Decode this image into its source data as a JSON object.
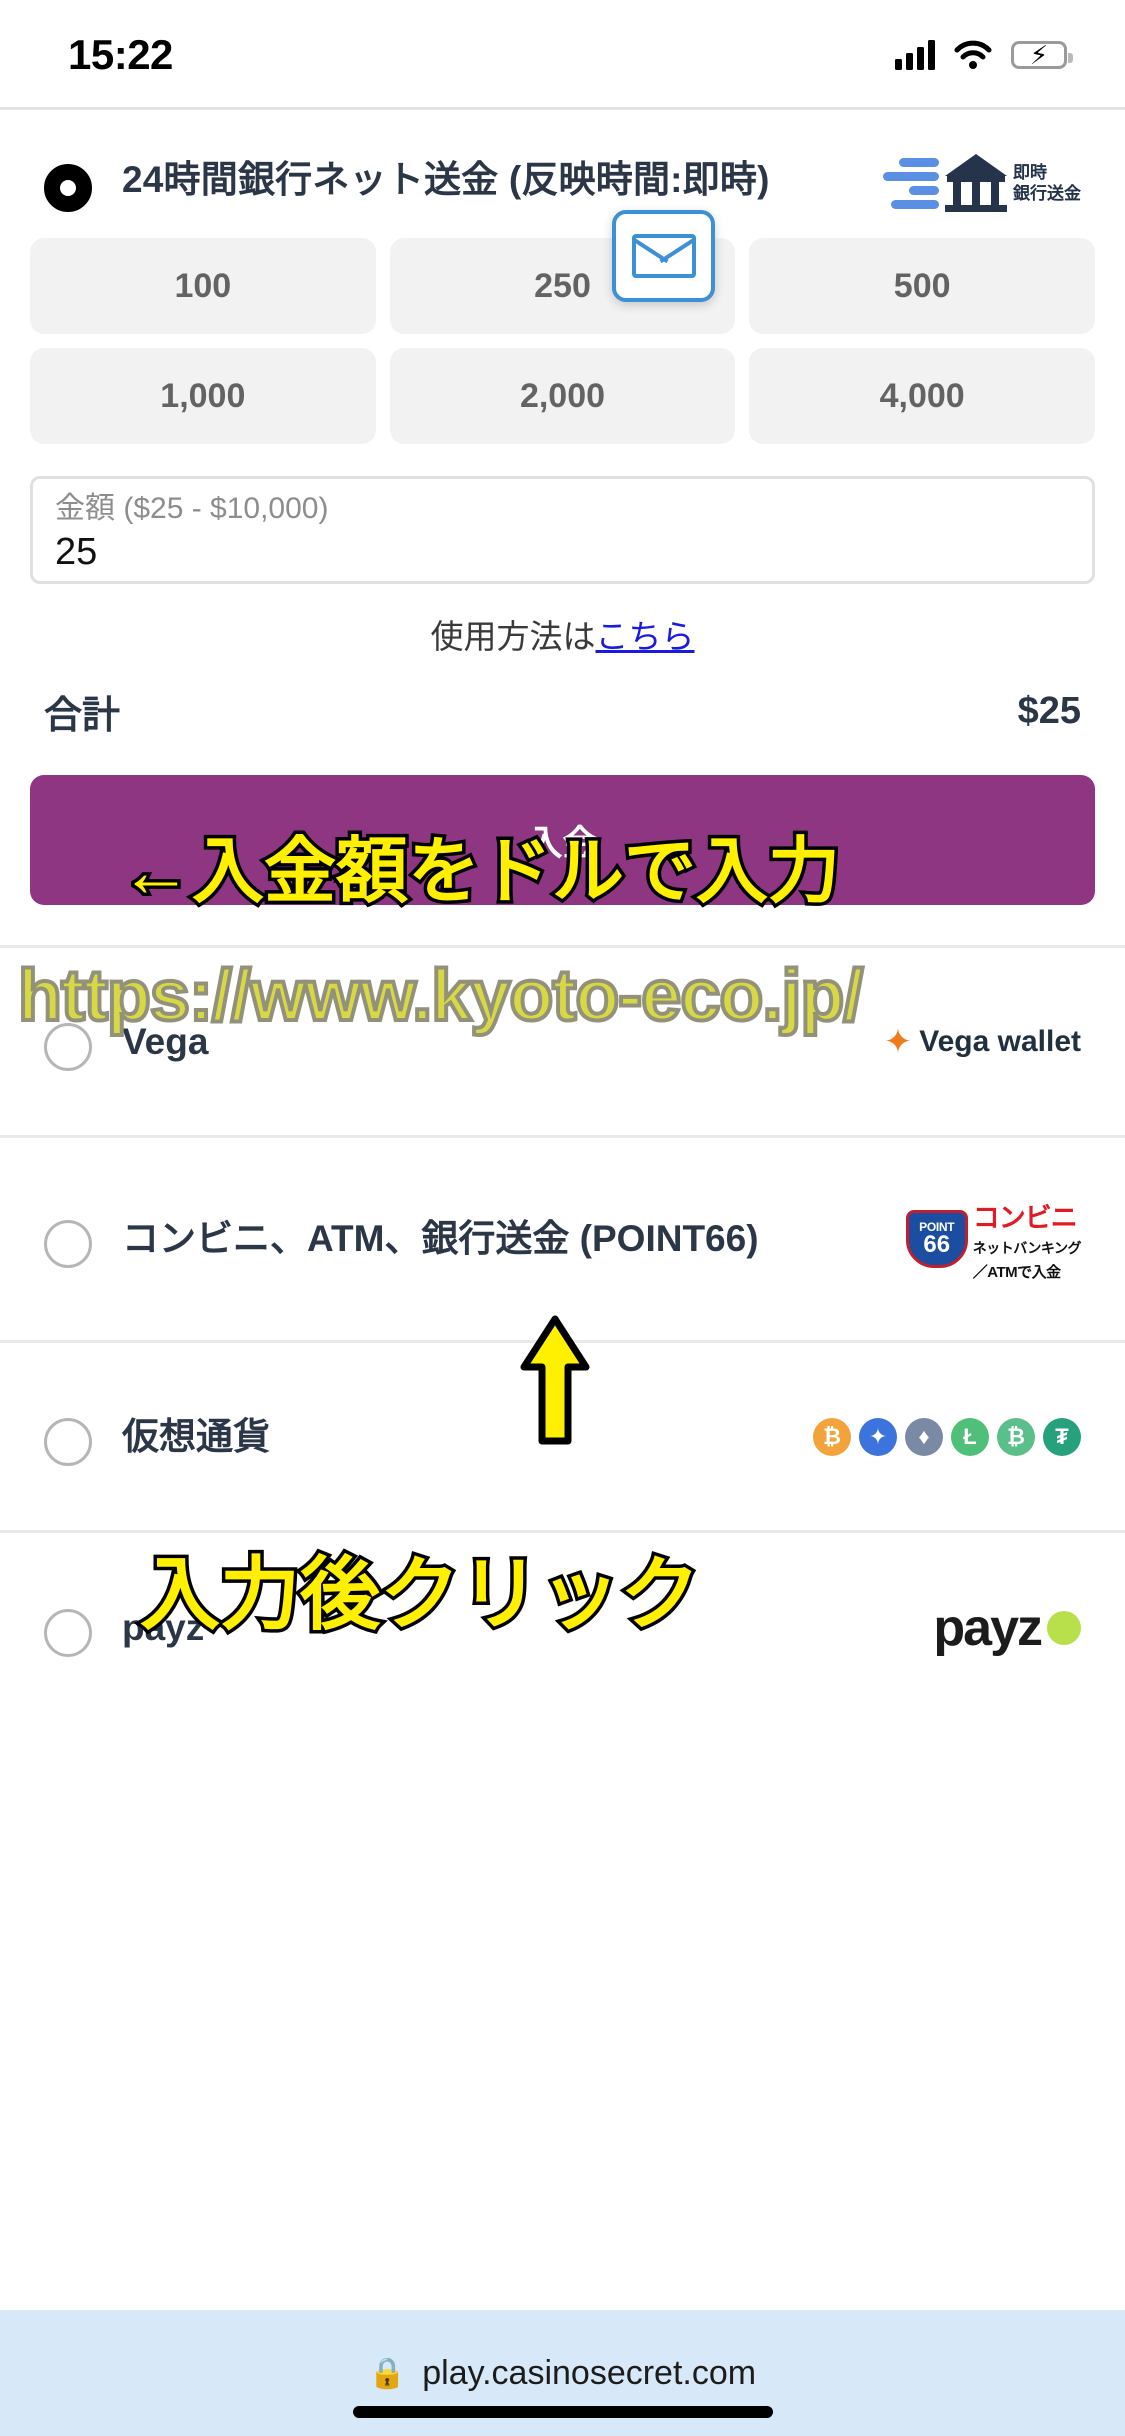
{
  "status_bar": {
    "time": "15:22",
    "signal_icon": "cellular-signal-icon",
    "wifi_icon": "wifi-icon",
    "battery_icon": "battery-charging-icon",
    "battery_color": "#3ddc5b"
  },
  "primary_method": {
    "title": "24時間銀行ネット送金 (反映時間:即時)",
    "selected": true,
    "logo_text_line1": "即時",
    "logo_text_line2": "銀行送金",
    "logo_name": "bank-transfer-logo",
    "tooltip_icon": "envelope-icon",
    "amount_presets": [
      "100",
      "250",
      "500",
      "1,000",
      "2,000",
      "4,000"
    ],
    "amount_input": {
      "placeholder": "金額 ($25 - $10,000)",
      "value": "25"
    },
    "help_text": "使用方法は",
    "help_link": "こちら",
    "total_label": "合計",
    "total_value": "$25",
    "submit_label": "入金",
    "submit_color": "#8e3681"
  },
  "other_methods": [
    {
      "title": "Vega",
      "selected": false,
      "logo_name": "vega-wallet-logo",
      "logo_text": "Vega wallet"
    },
    {
      "title": "コンビニ、ATM、銀行送金 (POINT66)",
      "selected": false,
      "logo_name": "point66-logo",
      "logo_badge_top": "POINT",
      "logo_badge_num": "66",
      "logo_text_top": "コンビニ",
      "logo_text_mid": "ネットバンキング",
      "logo_text_bot": "／ATMで入金"
    },
    {
      "title": "仮想通貨",
      "selected": false,
      "logo_name": "crypto-coins-logo",
      "coins": [
        {
          "symbol": "₿",
          "color": "#f2a33c"
        },
        {
          "symbol": "✦",
          "color": "#3c73dd"
        },
        {
          "symbol": "♦",
          "color": "#7a8aa5"
        },
        {
          "symbol": "Ł",
          "color": "#4fbf7a"
        },
        {
          "symbol": "₿",
          "color": "#5bbf8c"
        },
        {
          "symbol": "₮",
          "color": "#26a17b"
        }
      ]
    },
    {
      "title": "payz",
      "selected": false,
      "logo_name": "payz-logo",
      "logo_text": "payz"
    }
  ],
  "annotations": {
    "input_hint": "←入金額をドルで入力",
    "click_hint": "入力後クリック",
    "arrow_up_name": "up-arrow-annotation",
    "watermark_url": "https://www.kyoto-eco.jp/",
    "highlight_color": "#ffef00"
  },
  "browser_bar": {
    "lock_icon": "lock-icon",
    "url": "play.casinosecret.com"
  }
}
